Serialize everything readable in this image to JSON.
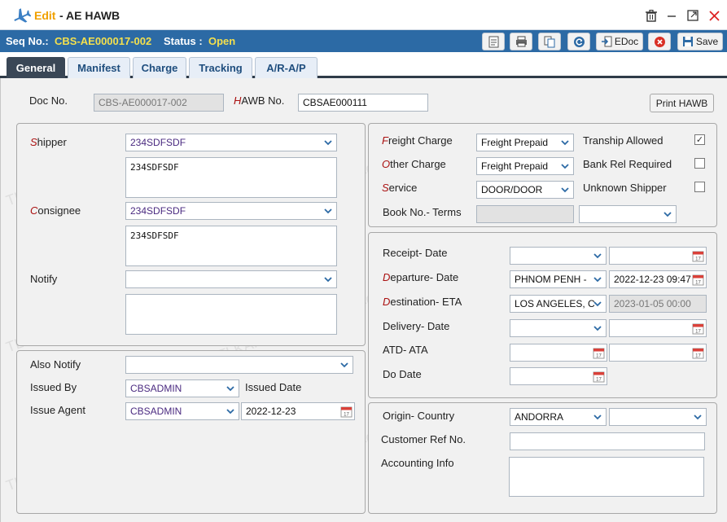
{
  "window": {
    "edit_label": "Edit",
    "title": " - AE HAWB"
  },
  "seqbar": {
    "seq_label": "Seq No.:",
    "seq_value": "CBS-AE000017-002",
    "status_label": "Status :",
    "status_value": "Open",
    "edoc_label": "EDoc",
    "save_label": "Save"
  },
  "tabs": [
    "General",
    "Manifest",
    "Charge",
    "Tracking",
    "A/R-A/P"
  ],
  "header": {
    "doc_no_label": "Doc No.",
    "doc_no_value": "CBS-AE000017-002",
    "hawb_label_first": "H",
    "hawb_label_rest": "AWB No.",
    "hawb_value": "CBSAE000111",
    "print_hawb_label": "Print HAWB"
  },
  "parties": {
    "shipper_label_first": "S",
    "shipper_label_rest": "hipper",
    "shipper_value": "234SDFSDF",
    "shipper_text": "234SDFSDF",
    "consignee_label_first": "C",
    "consignee_label_rest": "onsignee",
    "consignee_value": "234SDFSDF",
    "consignee_text": "234SDFSDF",
    "notify_label": "Notify",
    "notify_value": "",
    "notify_text": ""
  },
  "issue": {
    "also_notify_label": "Also Notify",
    "also_notify_value": "",
    "issued_by_label": "Issued By",
    "issued_by_value": "CBSADMIN",
    "issued_date_label": "Issued Date",
    "issue_agent_label": "Issue Agent",
    "issue_agent_value": "CBSADMIN",
    "issue_date_value": "2022-12-23"
  },
  "charges": {
    "freight_label_first": "F",
    "freight_label_rest": "reight Charge",
    "freight_value": "Freight Prepaid",
    "other_label_first": "O",
    "other_label_rest": "ther Charge",
    "other_value": "Freight Prepaid",
    "service_label_first": "S",
    "service_label_rest": "ervice",
    "service_value": "DOOR/DOOR",
    "book_label": "Book No.- Terms",
    "book_value": "",
    "terms_value": "",
    "tranship_label": "Tranship Allowed",
    "tranship_checked": "✓",
    "bank_label": "Bank Rel Required",
    "unknown_label": "Unknown Shipper"
  },
  "dates": {
    "receipt_label": "Receipt- Date",
    "receipt_place": "",
    "receipt_date": "",
    "departure_label_first": "D",
    "departure_label_rest": "eparture- Date",
    "departure_place": "PHNOM PENH - ",
    "departure_date": "2022-12-23 09:47",
    "destination_label_first": "D",
    "destination_label_rest": "estination- ETA",
    "destination_place": "LOS ANGELES, C",
    "destination_eta": "2023-01-05 00:00",
    "delivery_label": "Delivery- Date",
    "delivery_place": "",
    "delivery_date": "",
    "atd_label": "ATD- ATA",
    "atd_value": "",
    "ata_value": "",
    "do_label": "Do Date",
    "do_value": ""
  },
  "origin": {
    "origin_label": "Origin- Country",
    "origin_value": "ANDORRA",
    "country_value": "",
    "customer_ref_label": "Customer Ref No.",
    "customer_ref_value": "",
    "accounting_label": "Accounting Info",
    "accounting_value": ""
  },
  "watermark": "TLKA.CBS.Admin 2024-09-02",
  "colors": {
    "seqbar_bg": "#2c6aa5",
    "seq_value": "#f4e04d",
    "edit_label": "#f0a000",
    "required": "#aa1111",
    "active_tab": "#3a4756"
  }
}
